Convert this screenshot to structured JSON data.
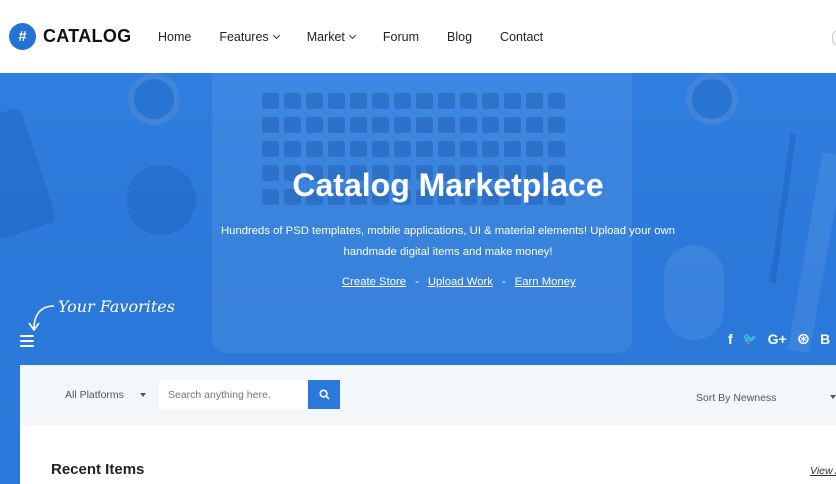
{
  "brand": {
    "mark": "#",
    "name": "CATALOG"
  },
  "nav": {
    "items": [
      {
        "label": "Home",
        "dropdown": false
      },
      {
        "label": "Features",
        "dropdown": true
      },
      {
        "label": "Market",
        "dropdown": true
      },
      {
        "label": "Forum",
        "dropdown": false
      },
      {
        "label": "Blog",
        "dropdown": false
      },
      {
        "label": "Contact",
        "dropdown": false
      }
    ]
  },
  "hero": {
    "title": "Catalog Marketplace",
    "subtitle_line1": "Hundreds of PSD templates, mobile applications, UI & material elements! Upload your own",
    "subtitle_line2": "handmade digital items and make money!",
    "links": [
      "Create Store",
      "Upload Work",
      "Earn Money"
    ],
    "separator": "-",
    "favorites_label": "Your Favorites"
  },
  "social": {
    "icons": [
      {
        "name": "facebook-icon",
        "glyph": "f"
      },
      {
        "name": "twitter-icon",
        "glyph": "🐦"
      },
      {
        "name": "google-plus-icon",
        "glyph": "G+"
      },
      {
        "name": "dribbble-icon",
        "glyph": "⊛"
      },
      {
        "name": "behance-icon",
        "glyph": "B"
      }
    ]
  },
  "search": {
    "platform_label": "All Platforms",
    "placeholder": "Search anything here.",
    "sort_label": "Sort By Newness"
  },
  "section": {
    "title": "Recent Items",
    "view_all": "View All"
  },
  "colors": {
    "accent": "#2a78d9",
    "hero": "#2f7fe0"
  }
}
